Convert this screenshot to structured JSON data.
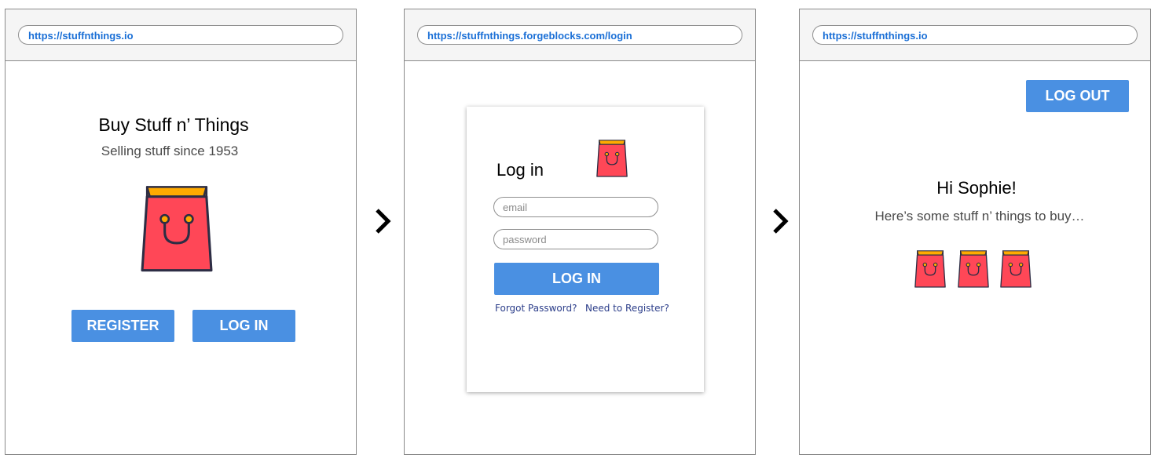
{
  "screens": [
    {
      "url": "https://stuffnthings.io",
      "title": "Buy Stuff n’ Things",
      "subtitle": "Selling stuff since 1953",
      "register_label": "REGISTER",
      "login_label": "LOG IN"
    },
    {
      "url": "https://stuffnthings.forgeblocks.com/login",
      "heading": "Log in",
      "email_placeholder": "email",
      "password_placeholder": "password",
      "login_label": "LOG IN",
      "forgot_label": "Forgot Password?",
      "register_link_label": "Need to Register?"
    },
    {
      "url": "https://stuffnthings.io",
      "logout_label": "LOG OUT",
      "greeting": "Hi Sophie!",
      "message": "Here’s some stuff n’ things to buy…"
    }
  ],
  "icons": {
    "bag": "shopping-bag-icon",
    "arrow": "chevron-right-icon"
  },
  "colors": {
    "button": "#4a90e2",
    "url_text": "#1a6fd6",
    "bag_body": "#ff4757",
    "bag_top": "#ffaa00",
    "bag_outline": "#2d2d44"
  }
}
